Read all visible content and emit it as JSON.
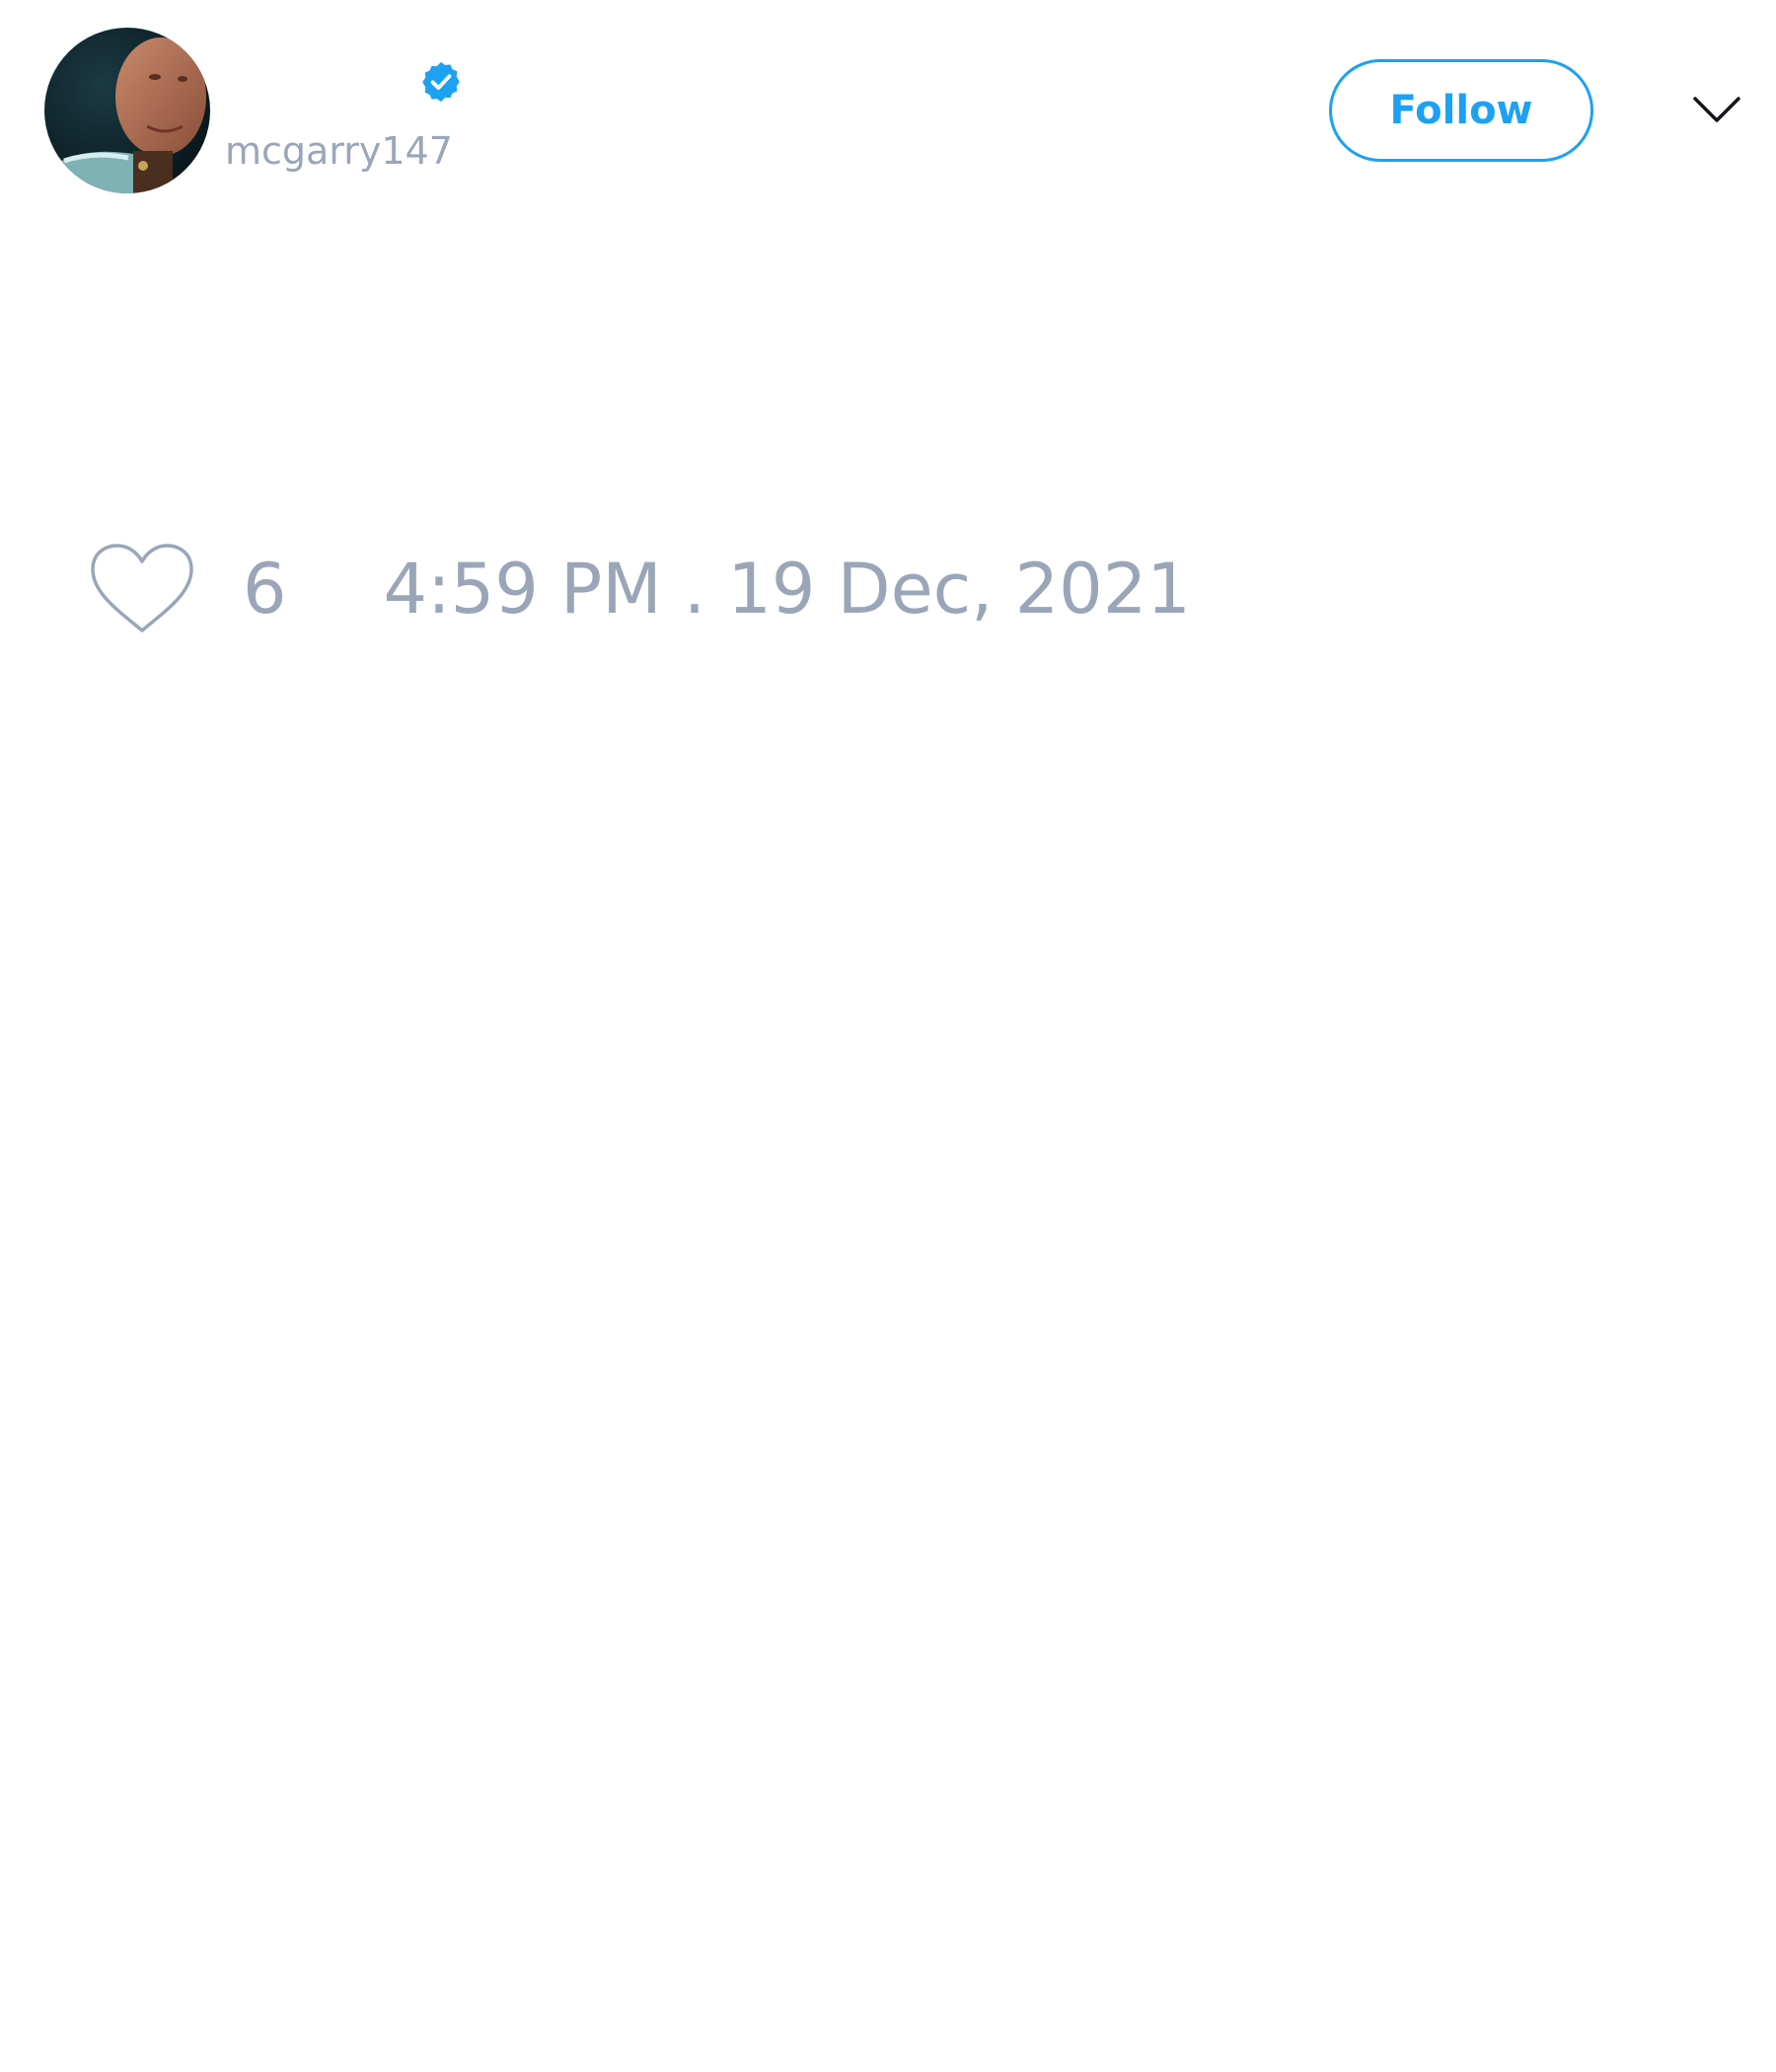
{
  "user": {
    "display_name": "",
    "handle": "mcgarry147",
    "verified": true,
    "avatar_icon": "profile-photo"
  },
  "header": {
    "follow_label": "Follow",
    "menu_icon": "chevron-down-icon"
  },
  "tweet": {
    "like_icon": "heart-icon",
    "like_count": "6",
    "timestamp": "4:59 PM . 19 Dec, 2021"
  },
  "colors": {
    "accent": "#1da1f2",
    "muted_text": "#9aa6b8",
    "background": "#ffffff"
  }
}
